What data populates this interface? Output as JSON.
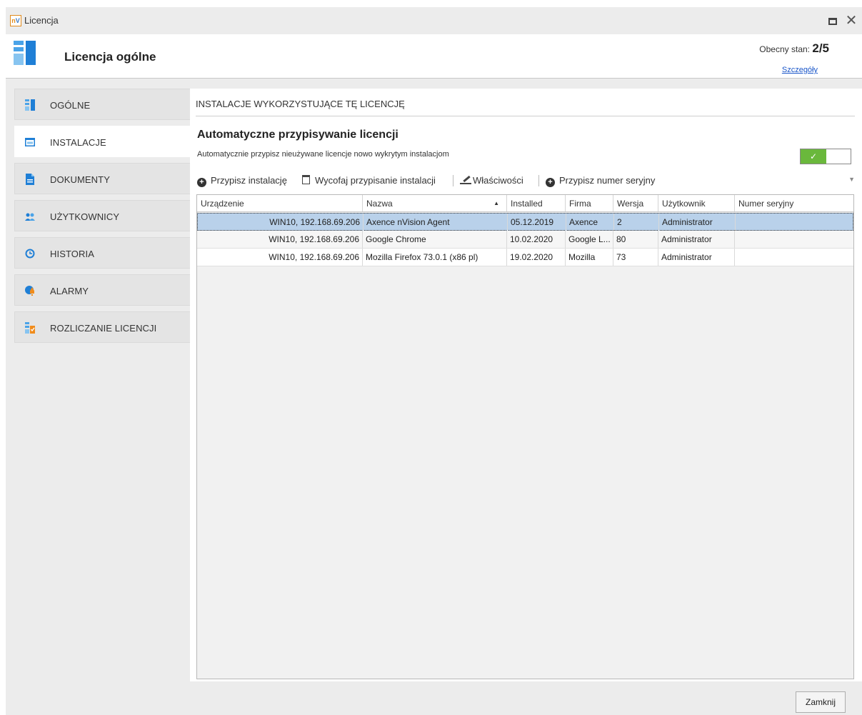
{
  "window": {
    "title": "Licencja",
    "logo_text": "nV"
  },
  "header": {
    "title": "Licencja ogólne",
    "status_label": "Obecny stan:",
    "status_value": "2/5",
    "details_link": "Szczegóły"
  },
  "sidebar": {
    "items": [
      {
        "label": "OGÓLNE",
        "icon": "general-icon",
        "active": false
      },
      {
        "label": "INSTALACJE",
        "icon": "installations-icon",
        "active": true
      },
      {
        "label": "DOKUMENTY",
        "icon": "document-icon",
        "active": false
      },
      {
        "label": "UŻYTKOWNICY",
        "icon": "users-icon",
        "active": false
      },
      {
        "label": "HISTORIA",
        "icon": "history-icon",
        "active": false
      },
      {
        "label": "ALARMY",
        "icon": "alarm-icon",
        "active": false
      },
      {
        "label": "ROZLICZANIE LICENCJI",
        "icon": "license-accounting-icon",
        "active": false
      }
    ]
  },
  "content": {
    "section_title": "INSTALACJE WYKORZYSTUJĄCE TĘ LICENCJĘ",
    "auto_title": "Automatyczne przypisywanie licencji",
    "auto_desc": "Automatycznie przypisz nieużywane licencje nowo wykrytym instalacjom",
    "auto_enabled": true
  },
  "toolbar": {
    "assign_install": "Przypisz instalację",
    "revoke_assign": "Wycofaj przypisanie instalacji",
    "properties": "Właściwości",
    "assign_serial": "Przypisz numer seryjny"
  },
  "table": {
    "columns": [
      "Urządzenie",
      "Nazwa",
      "Installed",
      "Firma",
      "Wersja",
      "Użytkownik",
      "Numer seryjny"
    ],
    "sorted_column": "Nazwa",
    "sort_direction": "asc",
    "rows": [
      [
        "WIN10, 192.168.69.206",
        "Axence nVision Agent",
        "05.12.2019",
        "Axence",
        "2",
        "Administrator",
        ""
      ],
      [
        "WIN10, 192.168.69.206",
        "Google Chrome",
        "10.02.2020",
        "Google L...",
        "80",
        "Administrator",
        ""
      ],
      [
        "WIN10, 192.168.69.206",
        "Mozilla Firefox 73.0.1 (x86 pl)",
        "19.02.2020",
        "Mozilla",
        "73",
        "Administrator",
        ""
      ]
    ],
    "selected_row": 0
  },
  "footer": {
    "close_label": "Zamknij"
  },
  "colors": {
    "accent_blue": "#1f7fd6",
    "toggle_green": "#6ab83c",
    "selection": "#b9d1ea"
  }
}
